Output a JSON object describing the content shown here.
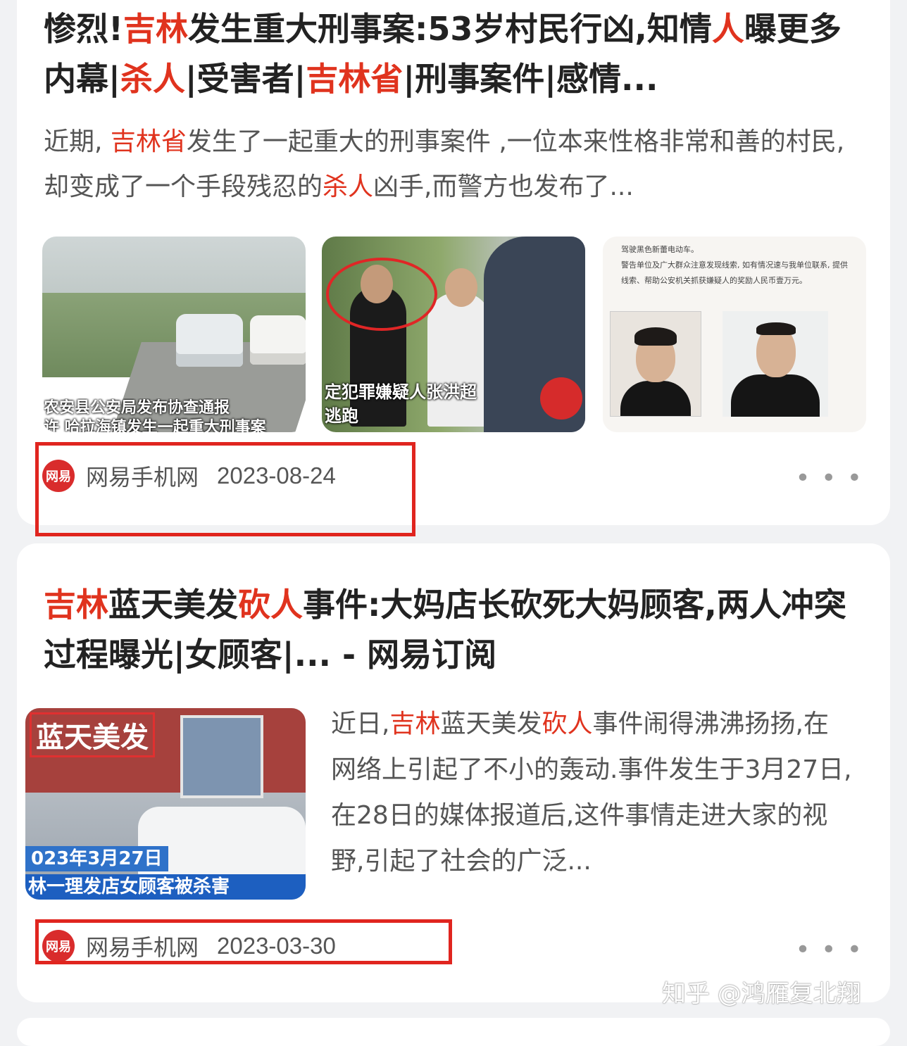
{
  "results": [
    {
      "title_parts": [
        {
          "text": "惨烈!",
          "hl": false
        },
        {
          "text": "吉林",
          "hl": true
        },
        {
          "text": "发生重大刑事案:53岁村民行凶,知情",
          "hl": false
        },
        {
          "text": "人",
          "hl": true
        },
        {
          "text": "曝更多内幕|",
          "hl": false
        },
        {
          "text": "杀人",
          "hl": true
        },
        {
          "text": "|受害者|",
          "hl": false
        },
        {
          "text": "吉林省",
          "hl": true
        },
        {
          "text": "|刑事案件|感情...",
          "hl": false
        }
      ],
      "snippet_parts": [
        {
          "text": "近期, ",
          "hl": false
        },
        {
          "text": "吉林省",
          "hl": true
        },
        {
          "text": "发生了一起重大的刑事案件 ,一位本来性格非常和善的村民,却变成了一个手段残忍的",
          "hl": false
        },
        {
          "text": "杀人",
          "hl": true
        },
        {
          "text": "凶手,而警方也发布了...",
          "hl": false
        }
      ],
      "thumb_captions": [
        "农安县公安局发布协查通报",
        "许 哈拉海镇发生一起重大刑事案",
        "定犯罪嫌疑人张洪超",
        "逃跑"
      ],
      "notice_text": [
        "驾驶黑色新蕾电动车。",
        "警告单位及广大群众注意发现线索, 如有情况速与我单位联系, 提供线索、帮助公安机关抓获嫌疑人的奖励人民币壹万元。"
      ],
      "source": "网易手机网",
      "date": "2023-08-24",
      "logo_text": "网易"
    },
    {
      "title_parts": [
        {
          "text": "吉林",
          "hl": true
        },
        {
          "text": "蓝天美发",
          "hl": false
        },
        {
          "text": "砍人",
          "hl": true
        },
        {
          "text": "事件:大妈店长砍死大妈顾客,两人冲突过程曝光|女顾客|... - 网易订阅",
          "hl": false
        }
      ],
      "snippet_parts": [
        {
          "text": "近日,",
          "hl": false
        },
        {
          "text": "吉林",
          "hl": true
        },
        {
          "text": "蓝天美发",
          "hl": false
        },
        {
          "text": "砍人",
          "hl": true
        },
        {
          "text": "事件闹得沸沸扬扬,在网络上引起了不小的轰动.事件发生于3月27日,在28日的媒体报道后,这件事情走进大家的视野,引起了社会的广泛...",
          "hl": false
        }
      ],
      "thumb_sign": "蓝天美发",
      "thumb_cap1": "023年3月27日",
      "thumb_cap2": "林一理发店女顾客被杀害",
      "source": "网易手机网",
      "date": "2023-03-30",
      "logo_text": "网易"
    }
  ],
  "more_label": "• • •",
  "watermark": "知乎 @鸿雁复北翔",
  "colors": {
    "highlight": "#e0331e",
    "annotation_box": "#e0251f",
    "card_bg": "#ffffff",
    "page_bg": "#f1f2f4"
  },
  "icons": [
    "netease-logo-icon",
    "more-options-icon"
  ]
}
